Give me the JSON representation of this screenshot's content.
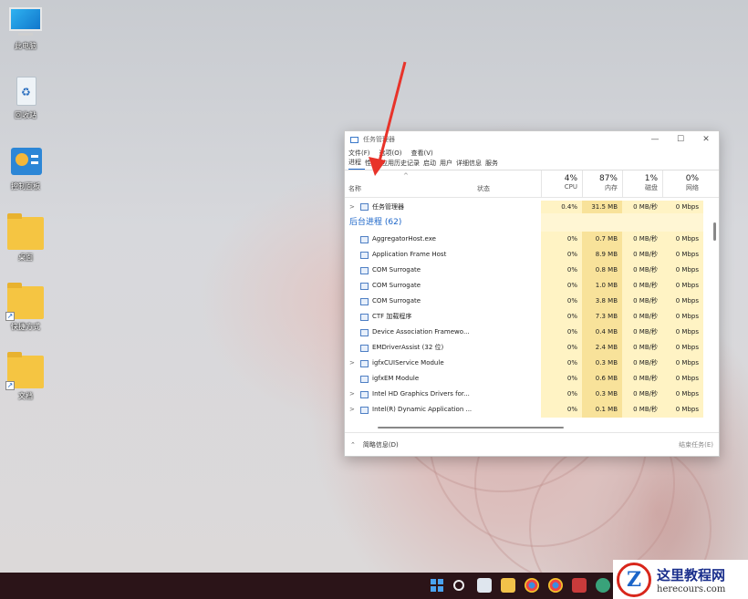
{
  "desktop": {
    "icons": [
      {
        "label": "此电脑",
        "icon": "computer-icon"
      },
      {
        "label": "回收站",
        "icon": "recycle-bin-icon"
      },
      {
        "label": "控制面板",
        "icon": "control-panel-icon"
      },
      {
        "label": "桌面",
        "icon": "folder-icon"
      },
      {
        "label": "快捷方式",
        "icon": "folder-shortcut-icon"
      },
      {
        "label": "文档",
        "icon": "folder-shortcut-icon"
      }
    ]
  },
  "task_manager": {
    "title": "任务管理器",
    "window_controls": {
      "minimize": "—",
      "maximize": "☐",
      "close": "✕"
    },
    "menu": [
      "文件(F)",
      "选项(O)",
      "查看(V)"
    ],
    "tabs": [
      "进程",
      "性能",
      "应用历史记录",
      "启动",
      "用户",
      "详细信息",
      "服务"
    ],
    "active_tab": "进程",
    "columns": {
      "name": "名称",
      "status": "状态",
      "cpu": {
        "pct": "4%",
        "label": "CPU"
      },
      "memory": {
        "pct": "87%",
        "label": "内存"
      },
      "disk": {
        "pct": "1%",
        "label": "磁盘"
      },
      "network": {
        "pct": "0%",
        "label": "网络"
      }
    },
    "app_row": {
      "name": "任务管理器",
      "cpu": "0.4%",
      "mem": "31.5 MB",
      "disk": "0 MB/秒",
      "net": "0 Mbps"
    },
    "group_header": "后台进程 (62)",
    "processes": [
      {
        "name": "AggregatorHost.exe",
        "expand": "",
        "cpu": "0%",
        "mem": "0.7 MB",
        "disk": "0 MB/秒",
        "net": "0 Mbps"
      },
      {
        "name": "Application Frame Host",
        "expand": "",
        "cpu": "0%",
        "mem": "8.9 MB",
        "disk": "0 MB/秒",
        "net": "0 Mbps"
      },
      {
        "name": "COM Surrogate",
        "expand": "",
        "cpu": "0%",
        "mem": "0.8 MB",
        "disk": "0 MB/秒",
        "net": "0 Mbps"
      },
      {
        "name": "COM Surrogate",
        "expand": "",
        "cpu": "0%",
        "mem": "1.0 MB",
        "disk": "0 MB/秒",
        "net": "0 Mbps"
      },
      {
        "name": "COM Surrogate",
        "expand": "",
        "cpu": "0%",
        "mem": "3.8 MB",
        "disk": "0 MB/秒",
        "net": "0 Mbps"
      },
      {
        "name": "CTF 加载程序",
        "expand": "",
        "cpu": "0%",
        "mem": "7.3 MB",
        "disk": "0 MB/秒",
        "net": "0 Mbps"
      },
      {
        "name": "Device Association Framewo...",
        "expand": "",
        "cpu": "0%",
        "mem": "0.4 MB",
        "disk": "0 MB/秒",
        "net": "0 Mbps"
      },
      {
        "name": "EMDriverAssist (32 位)",
        "expand": "",
        "cpu": "0%",
        "mem": "2.4 MB",
        "disk": "0 MB/秒",
        "net": "0 Mbps"
      },
      {
        "name": "igfxCUIService Module",
        "expand": ">",
        "cpu": "0%",
        "mem": "0.3 MB",
        "disk": "0 MB/秒",
        "net": "0 Mbps"
      },
      {
        "name": "igfxEM Module",
        "expand": "",
        "cpu": "0%",
        "mem": "0.6 MB",
        "disk": "0 MB/秒",
        "net": "0 Mbps"
      },
      {
        "name": "Intel HD Graphics Drivers for...",
        "expand": ">",
        "cpu": "0%",
        "mem": "0.3 MB",
        "disk": "0 MB/秒",
        "net": "0 Mbps"
      },
      {
        "name": "Intel(R) Dynamic Application ...",
        "expand": ">",
        "cpu": "0%",
        "mem": "0.1 MB",
        "disk": "0 MB/秒",
        "net": "0 Mbps"
      }
    ],
    "footer": {
      "less_details": "简略信息(D)",
      "end_task": "结束任务(E)"
    }
  },
  "annotation": {
    "arrow_color": "#e8332a"
  },
  "watermark": {
    "title": "这里教程网",
    "url": "herecours.com",
    "logo_letter": "Z"
  },
  "colors": {
    "accent": "#1a64c8",
    "heat_light": "#fff3c4",
    "heat_mid": "#f8e29a"
  }
}
